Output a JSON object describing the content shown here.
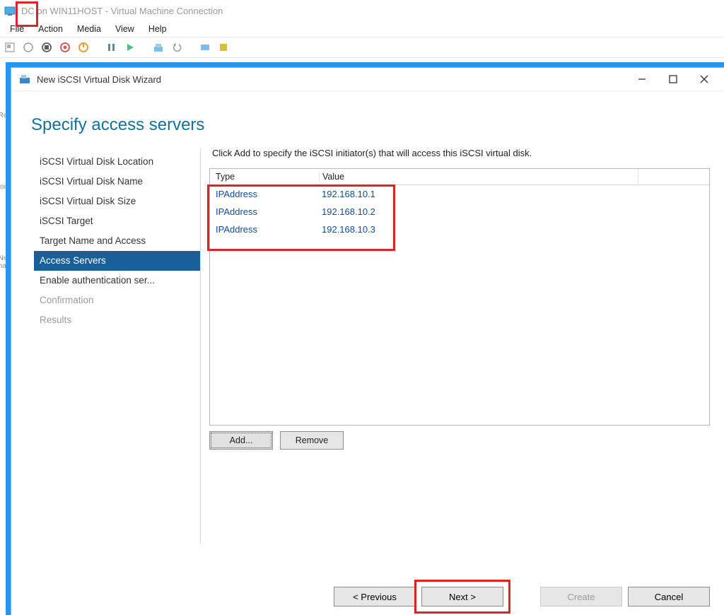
{
  "vm": {
    "title": "DC on WIN11HOST - Virtual Machine Connection",
    "menu": {
      "file": "File",
      "action": "Action",
      "media": "Media",
      "view": "View",
      "help": "Help"
    }
  },
  "wizard": {
    "window_title": "New iSCSI Virtual Disk Wizard",
    "heading": "Specify access servers",
    "instruction": "Click Add to specify the iSCSI initiator(s) that will access this iSCSI virtual disk.",
    "nav": {
      "location": "iSCSI Virtual Disk Location",
      "name": "iSCSI Virtual Disk Name",
      "size": "iSCSI Virtual Disk Size",
      "target": "iSCSI Target",
      "targetname": "Target Name and Access",
      "access": "Access Servers",
      "auth": "Enable authentication ser...",
      "confirm": "Confirmation",
      "results": "Results"
    },
    "table": {
      "col_type": "Type",
      "col_value": "Value",
      "rows": [
        {
          "type": "IPAddress",
          "value": "192.168.10.1"
        },
        {
          "type": "IPAddress",
          "value": "192.168.10.2"
        },
        {
          "type": "IPAddress",
          "value": "192.168.10.3"
        }
      ]
    },
    "buttons": {
      "add": "Add...",
      "remove": "Remove",
      "previous": "< Previous",
      "next": "Next >",
      "create": "Create",
      "cancel": "Cancel"
    }
  }
}
